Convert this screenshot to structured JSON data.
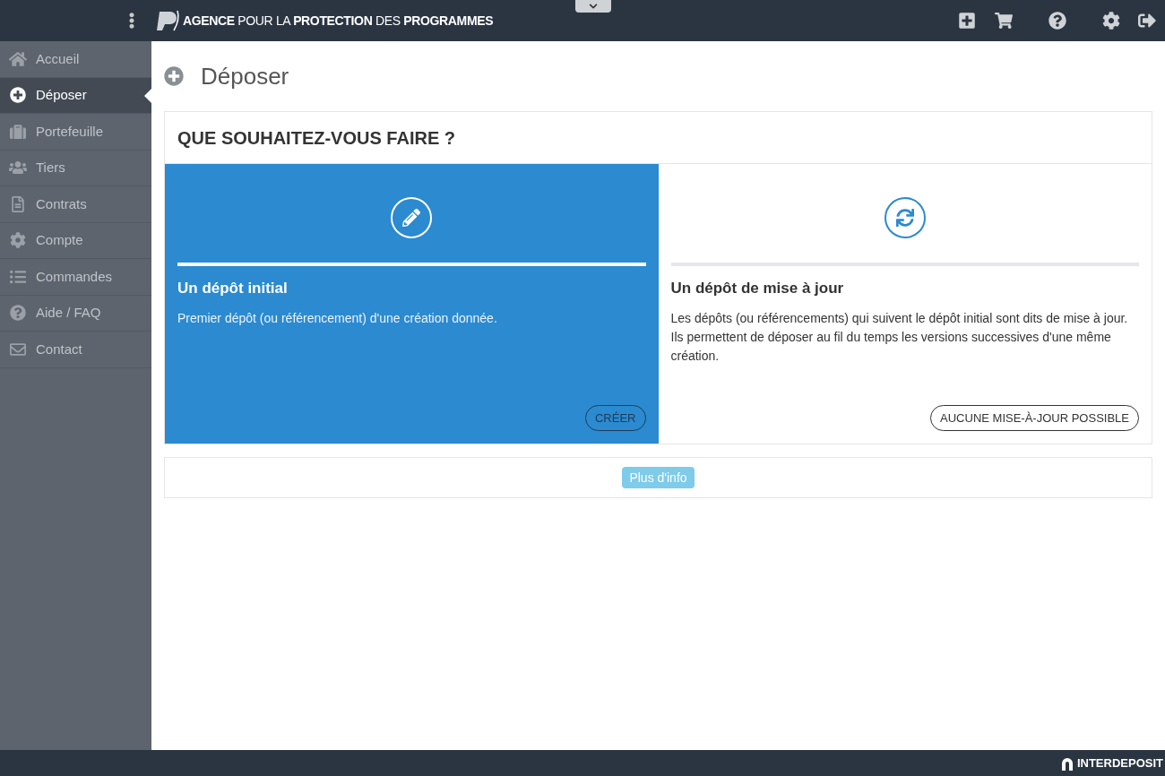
{
  "header": {
    "logo_text": "**AGENCE** POUR LA **PROTECTION** DES **PROGRAMMES**"
  },
  "sidebar": {
    "items": [
      {
        "label": "Accueil",
        "selected": false
      },
      {
        "label": "Déposer",
        "selected": true
      },
      {
        "label": "Portefeuille",
        "selected": false
      },
      {
        "label": "Tiers",
        "selected": false
      },
      {
        "label": "Contrats",
        "selected": false
      },
      {
        "label": "Compte",
        "selected": false
      },
      {
        "label": "Commandes",
        "selected": false
      },
      {
        "label": "Aide / FAQ",
        "selected": false
      },
      {
        "label": "Contact",
        "selected": false
      }
    ]
  },
  "page": {
    "title": "Déposer",
    "panel_title": "QUE SOUHAITEZ-VOUS FAIRE ?",
    "options": [
      {
        "title": "Un dépôt initial",
        "description": "Premier dépôt (ou référencement) d'une création donnée.",
        "button": "CRÉER",
        "selected": true
      },
      {
        "title": "Un dépôt de mise à jour",
        "description": "Les dépôts (ou référencements) qui suivent le dépôt initial sont dits de mise à jour. Ils permettent de déposer au fil du temps les versions successives d'une même création.",
        "button": "AUCUNE MISE-À-JOUR POSSIBLE",
        "selected": false
      }
    ],
    "info_button": "Plus d'info"
  },
  "footer": {
    "brand": "INTERDEPOSIT"
  }
}
